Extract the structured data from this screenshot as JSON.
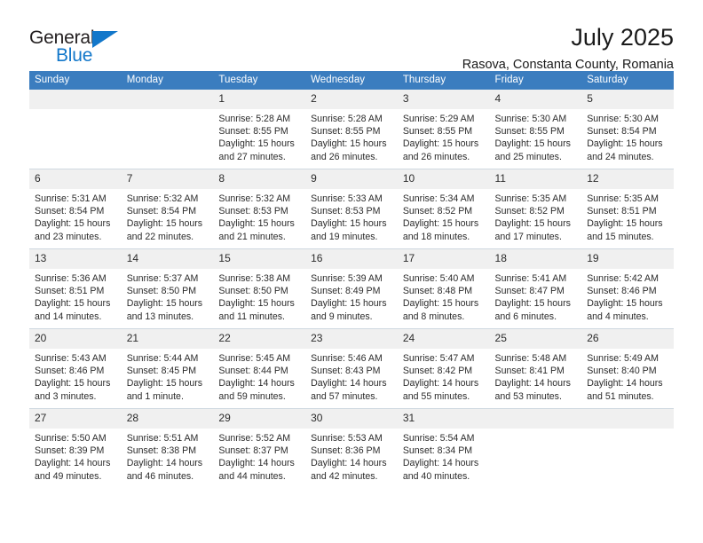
{
  "brand": {
    "name_top": "General",
    "name_bottom": "Blue",
    "accent_color": "#1277ca"
  },
  "header": {
    "title": "July 2025",
    "subtitle": "Rasova, Constanta County, Romania"
  },
  "calendar": {
    "header_color": "#3b7dbf",
    "daynum_band_color": "#f0f0f0",
    "weekdays": [
      "Sunday",
      "Monday",
      "Tuesday",
      "Wednesday",
      "Thursday",
      "Friday",
      "Saturday"
    ],
    "weeks": [
      [
        {
          "day": "",
          "empty": true
        },
        {
          "day": "",
          "empty": true
        },
        {
          "day": "1",
          "sunrise": "Sunrise: 5:28 AM",
          "sunset": "Sunset: 8:55 PM",
          "daylight1": "Daylight: 15 hours",
          "daylight2": "and 27 minutes."
        },
        {
          "day": "2",
          "sunrise": "Sunrise: 5:28 AM",
          "sunset": "Sunset: 8:55 PM",
          "daylight1": "Daylight: 15 hours",
          "daylight2": "and 26 minutes."
        },
        {
          "day": "3",
          "sunrise": "Sunrise: 5:29 AM",
          "sunset": "Sunset: 8:55 PM",
          "daylight1": "Daylight: 15 hours",
          "daylight2": "and 26 minutes."
        },
        {
          "day": "4",
          "sunrise": "Sunrise: 5:30 AM",
          "sunset": "Sunset: 8:55 PM",
          "daylight1": "Daylight: 15 hours",
          "daylight2": "and 25 minutes."
        },
        {
          "day": "5",
          "sunrise": "Sunrise: 5:30 AM",
          "sunset": "Sunset: 8:54 PM",
          "daylight1": "Daylight: 15 hours",
          "daylight2": "and 24 minutes."
        }
      ],
      [
        {
          "day": "6",
          "sunrise": "Sunrise: 5:31 AM",
          "sunset": "Sunset: 8:54 PM",
          "daylight1": "Daylight: 15 hours",
          "daylight2": "and 23 minutes."
        },
        {
          "day": "7",
          "sunrise": "Sunrise: 5:32 AM",
          "sunset": "Sunset: 8:54 PM",
          "daylight1": "Daylight: 15 hours",
          "daylight2": "and 22 minutes."
        },
        {
          "day": "8",
          "sunrise": "Sunrise: 5:32 AM",
          "sunset": "Sunset: 8:53 PM",
          "daylight1": "Daylight: 15 hours",
          "daylight2": "and 21 minutes."
        },
        {
          "day": "9",
          "sunrise": "Sunrise: 5:33 AM",
          "sunset": "Sunset: 8:53 PM",
          "daylight1": "Daylight: 15 hours",
          "daylight2": "and 19 minutes."
        },
        {
          "day": "10",
          "sunrise": "Sunrise: 5:34 AM",
          "sunset": "Sunset: 8:52 PM",
          "daylight1": "Daylight: 15 hours",
          "daylight2": "and 18 minutes."
        },
        {
          "day": "11",
          "sunrise": "Sunrise: 5:35 AM",
          "sunset": "Sunset: 8:52 PM",
          "daylight1": "Daylight: 15 hours",
          "daylight2": "and 17 minutes."
        },
        {
          "day": "12",
          "sunrise": "Sunrise: 5:35 AM",
          "sunset": "Sunset: 8:51 PM",
          "daylight1": "Daylight: 15 hours",
          "daylight2": "and 15 minutes."
        }
      ],
      [
        {
          "day": "13",
          "sunrise": "Sunrise: 5:36 AM",
          "sunset": "Sunset: 8:51 PM",
          "daylight1": "Daylight: 15 hours",
          "daylight2": "and 14 minutes."
        },
        {
          "day": "14",
          "sunrise": "Sunrise: 5:37 AM",
          "sunset": "Sunset: 8:50 PM",
          "daylight1": "Daylight: 15 hours",
          "daylight2": "and 13 minutes."
        },
        {
          "day": "15",
          "sunrise": "Sunrise: 5:38 AM",
          "sunset": "Sunset: 8:50 PM",
          "daylight1": "Daylight: 15 hours",
          "daylight2": "and 11 minutes."
        },
        {
          "day": "16",
          "sunrise": "Sunrise: 5:39 AM",
          "sunset": "Sunset: 8:49 PM",
          "daylight1": "Daylight: 15 hours",
          "daylight2": "and 9 minutes."
        },
        {
          "day": "17",
          "sunrise": "Sunrise: 5:40 AM",
          "sunset": "Sunset: 8:48 PM",
          "daylight1": "Daylight: 15 hours",
          "daylight2": "and 8 minutes."
        },
        {
          "day": "18",
          "sunrise": "Sunrise: 5:41 AM",
          "sunset": "Sunset: 8:47 PM",
          "daylight1": "Daylight: 15 hours",
          "daylight2": "and 6 minutes."
        },
        {
          "day": "19",
          "sunrise": "Sunrise: 5:42 AM",
          "sunset": "Sunset: 8:46 PM",
          "daylight1": "Daylight: 15 hours",
          "daylight2": "and 4 minutes."
        }
      ],
      [
        {
          "day": "20",
          "sunrise": "Sunrise: 5:43 AM",
          "sunset": "Sunset: 8:46 PM",
          "daylight1": "Daylight: 15 hours",
          "daylight2": "and 3 minutes."
        },
        {
          "day": "21",
          "sunrise": "Sunrise: 5:44 AM",
          "sunset": "Sunset: 8:45 PM",
          "daylight1": "Daylight: 15 hours",
          "daylight2": "and 1 minute."
        },
        {
          "day": "22",
          "sunrise": "Sunrise: 5:45 AM",
          "sunset": "Sunset: 8:44 PM",
          "daylight1": "Daylight: 14 hours",
          "daylight2": "and 59 minutes."
        },
        {
          "day": "23",
          "sunrise": "Sunrise: 5:46 AM",
          "sunset": "Sunset: 8:43 PM",
          "daylight1": "Daylight: 14 hours",
          "daylight2": "and 57 minutes."
        },
        {
          "day": "24",
          "sunrise": "Sunrise: 5:47 AM",
          "sunset": "Sunset: 8:42 PM",
          "daylight1": "Daylight: 14 hours",
          "daylight2": "and 55 minutes."
        },
        {
          "day": "25",
          "sunrise": "Sunrise: 5:48 AM",
          "sunset": "Sunset: 8:41 PM",
          "daylight1": "Daylight: 14 hours",
          "daylight2": "and 53 minutes."
        },
        {
          "day": "26",
          "sunrise": "Sunrise: 5:49 AM",
          "sunset": "Sunset: 8:40 PM",
          "daylight1": "Daylight: 14 hours",
          "daylight2": "and 51 minutes."
        }
      ],
      [
        {
          "day": "27",
          "sunrise": "Sunrise: 5:50 AM",
          "sunset": "Sunset: 8:39 PM",
          "daylight1": "Daylight: 14 hours",
          "daylight2": "and 49 minutes."
        },
        {
          "day": "28",
          "sunrise": "Sunrise: 5:51 AM",
          "sunset": "Sunset: 8:38 PM",
          "daylight1": "Daylight: 14 hours",
          "daylight2": "and 46 minutes."
        },
        {
          "day": "29",
          "sunrise": "Sunrise: 5:52 AM",
          "sunset": "Sunset: 8:37 PM",
          "daylight1": "Daylight: 14 hours",
          "daylight2": "and 44 minutes."
        },
        {
          "day": "30",
          "sunrise": "Sunrise: 5:53 AM",
          "sunset": "Sunset: 8:36 PM",
          "daylight1": "Daylight: 14 hours",
          "daylight2": "and 42 minutes."
        },
        {
          "day": "31",
          "sunrise": "Sunrise: 5:54 AM",
          "sunset": "Sunset: 8:34 PM",
          "daylight1": "Daylight: 14 hours",
          "daylight2": "and 40 minutes."
        },
        {
          "day": "",
          "empty": true
        },
        {
          "day": "",
          "empty": true
        }
      ]
    ]
  }
}
